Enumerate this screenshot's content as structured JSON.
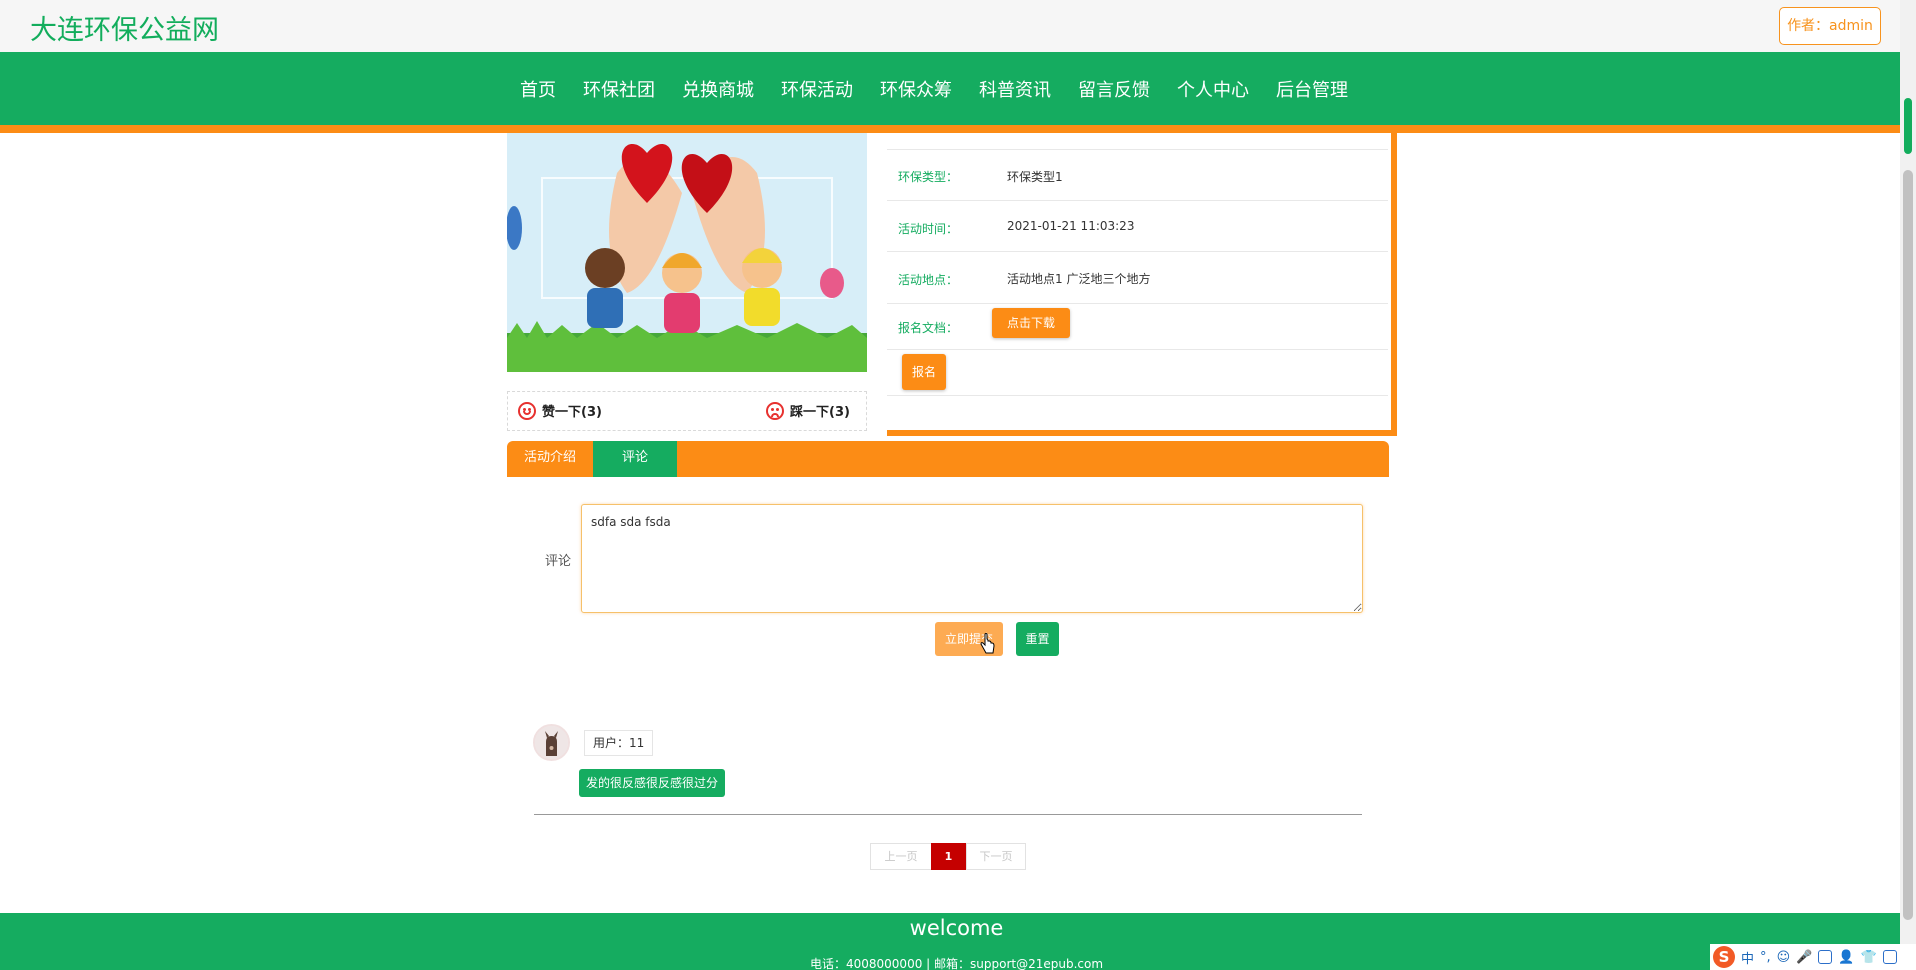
{
  "site": {
    "title": "大连环保公益网",
    "author_label": "作者：admin"
  },
  "nav": {
    "items": [
      "首页",
      "环保社团",
      "兑换商城",
      "环保活动",
      "环保众筹",
      "科普资讯",
      "留言反馈",
      "个人中心",
      "后台管理"
    ]
  },
  "actions": {
    "like": "赞一下(3)",
    "dislike": "踩一下(3)"
  },
  "details": {
    "type_label": "环保类型：",
    "type_value": "环保类型1",
    "time_label": "活动时间：",
    "time_value": "2021-01-21 11:03:23",
    "place_label": "活动地点：",
    "place_value": "活动地点1 广泛地三个地方",
    "doc_label": "报名文档：",
    "download_button": "点击下载",
    "signup_button": "报名"
  },
  "tabs": [
    "活动介绍",
    "评论"
  ],
  "comment_form": {
    "label": "评论",
    "value": "sdfa sda fsda",
    "submit": "立即提交",
    "reset": "重置"
  },
  "comments": [
    {
      "user": "用户：11",
      "content": "发的很反感很反感很过分"
    }
  ],
  "pagination": {
    "prev": "上一页",
    "current": "1",
    "next": "下一页"
  },
  "footer": {
    "title": "welcome",
    "contact": "电话：4008000000 | 邮箱：support@21epub.com"
  },
  "ime": {
    "logo": "S",
    "mode": "中"
  },
  "colors": {
    "brand_green": "#15ac60",
    "accent_orange": "#fc8c15",
    "page_current": "#c50000"
  }
}
